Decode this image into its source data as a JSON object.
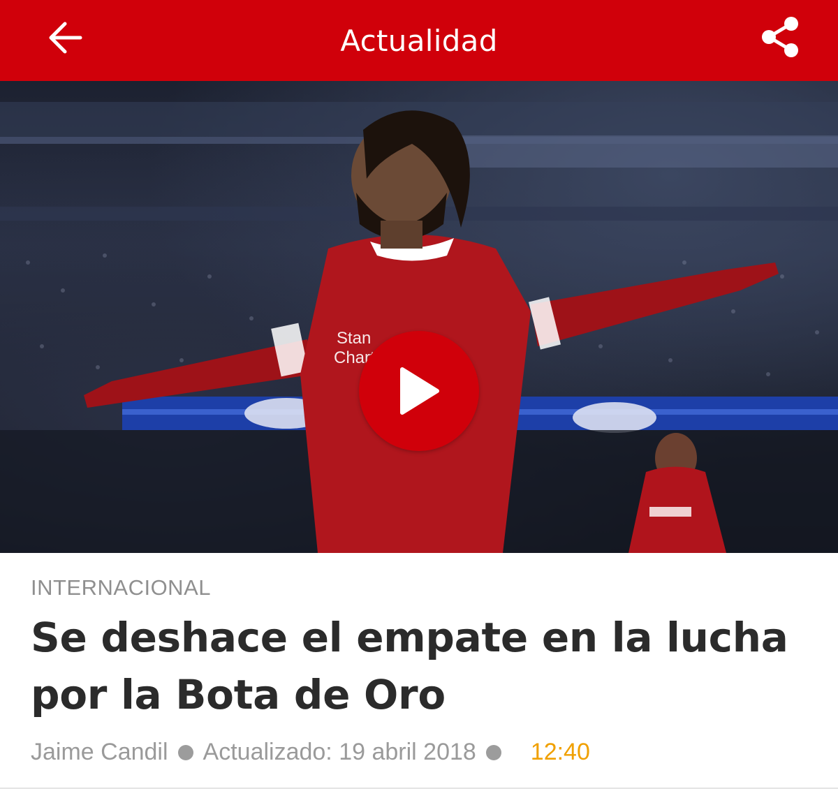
{
  "header": {
    "title": "Actualidad",
    "back_icon": "arrow-left-icon",
    "share_icon": "share-icon",
    "background_color": "#d0000a"
  },
  "media": {
    "type": "video",
    "play_icon": "play-icon",
    "play_button_color": "#d0000a",
    "jersey_sponsor": "Standard Chartered"
  },
  "article": {
    "section": "INTERNACIONAL",
    "headline": "Se deshace el empate en la lucha por la Bota de Oro",
    "author": "Jaime Candil",
    "updated_label": "Actualizado: 19 abril 2018",
    "time": "12:40",
    "time_color": "#f0a000"
  }
}
